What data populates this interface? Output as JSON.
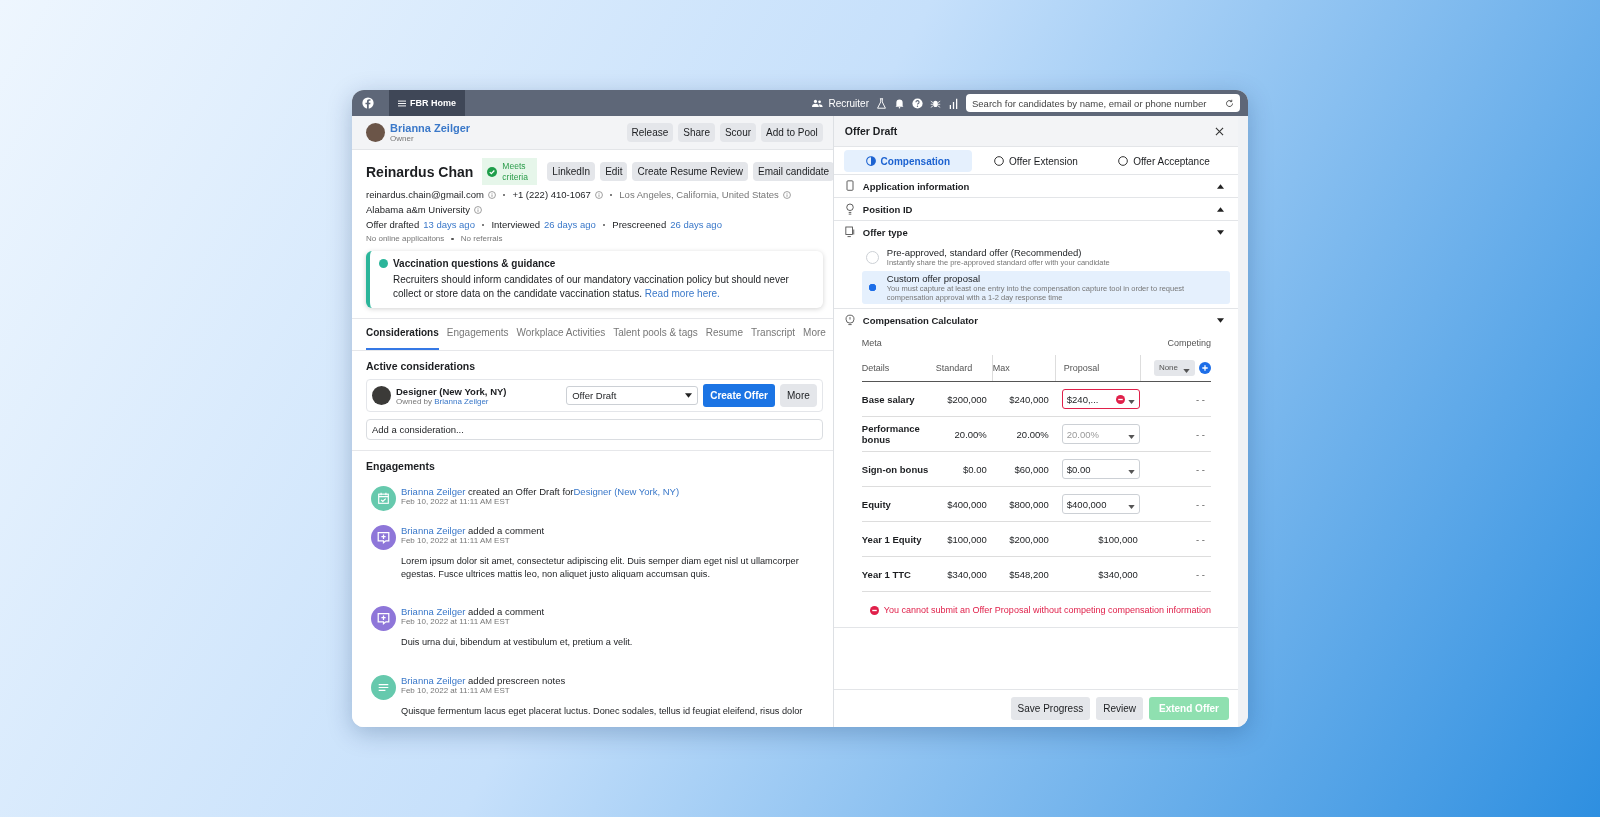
{
  "topbar": {
    "home_tab": "FBR Home",
    "role": "Recruiter",
    "search": {
      "placeholder": "Search for candidates by name, email or phone number"
    }
  },
  "owner": {
    "name": "Brianna Zeilger",
    "role": "Owner",
    "buttons": [
      "Release",
      "Share",
      "Scour",
      "Add to Pool"
    ]
  },
  "candidate": {
    "name": "Reinardus Chan",
    "badge": "Meets criteria",
    "buttons": [
      "LinkedIn",
      "Edit",
      "Create Resume Review",
      "Email candidate"
    ],
    "email": "reinardus.chain@gmail.com",
    "phone": "+1 (222) 410-1067",
    "location": "Los Angeles, California, United States",
    "school": "Alabama a&m University",
    "milestones": [
      {
        "label": "Offer drafted",
        "when": "13 days ago"
      },
      {
        "label": "Interviewed",
        "when": "26 days ago"
      },
      {
        "label": "Prescreened",
        "when": "26 days ago"
      }
    ],
    "notes": [
      "No online applicaitons",
      "No referrals"
    ]
  },
  "notice": {
    "title": "Vaccination questions & guidance",
    "text": "Recruiters should inform candidates of our mandatory vaccination policy but should never collect or store data on the candidate vaccination status.",
    "link": "Read more here."
  },
  "tabs": [
    {
      "label": "Considerations",
      "selected": true
    },
    {
      "label": "Engagements",
      "selected": false
    },
    {
      "label": "Workplace Activities",
      "selected": false
    },
    {
      "label": "Talent pools & tags",
      "selected": false
    },
    {
      "label": "Resume",
      "selected": false
    },
    {
      "label": "Transcript",
      "selected": false
    },
    {
      "label": "More",
      "selected": false
    }
  ],
  "active_considerations": {
    "title": "Active considerations",
    "items": [
      {
        "role": "Designer (New York, NY)",
        "owner_prefix": "Owned by",
        "owner": "Brianna Zeilger",
        "stage": "Offer Draft",
        "primary": "Create Offer",
        "more": "More"
      }
    ],
    "add": {
      "placeholder": "Add a consideration..."
    }
  },
  "engagements": {
    "title": "Engagements",
    "items": [
      {
        "kind": "offer",
        "actor": "Brianna Zeilger",
        "action": "created an Offer Draft for",
        "target": "Designer (New York, NY)",
        "time": "Feb 10, 2022 at 11:11 AM EST"
      },
      {
        "kind": "comment",
        "actor": "Brianna Zeilger",
        "action": "added a comment",
        "time": "Feb 10, 2022 at 11:11 AM EST",
        "body": "Lorem ipsum dolor sit amet, consectetur adipiscing elit. Duis semper diam eget nisl ut ullamcorper egestas. Fusce ultrices mattis leo, non aliquet justo aliquam accumsan quis."
      },
      {
        "kind": "comment",
        "actor": "Brianna Zeilger",
        "action": "added a comment",
        "time": "Feb 10, 2022 at 11:11 AM EST",
        "body": "Duis urna dui, bibendum at vestibulum et, pretium a velit."
      },
      {
        "kind": "notes",
        "actor": "Brianna Zeilger",
        "action": "added prescreen notes",
        "time": "Feb 10, 2022 at 11:11 AM EST",
        "body": "Quisque fermentum lacus eget placerat luctus. Donec sodales, tellus id feugiat eleifend, risus dolor"
      }
    ]
  },
  "offer": {
    "title": "Offer Draft",
    "steps": [
      {
        "label": "Compensation",
        "selected": true
      },
      {
        "label": "Offer Extension",
        "selected": false
      },
      {
        "label": "Offer Acceptance",
        "selected": false
      }
    ],
    "sections": [
      {
        "kind": "application",
        "title": "Application information",
        "expanded": false
      },
      {
        "kind": "position",
        "title": "Position ID",
        "expanded": false
      },
      {
        "kind": "offer_type",
        "title": "Offer type",
        "expanded": true
      },
      {
        "kind": "calculator",
        "title": "Compensation Calculator",
        "expanded": true
      }
    ],
    "offer_types": [
      {
        "title": "Pre-approved, standard offer (Recommended)",
        "subtitle": "Instantly share the pre-approved standard offer with your candidate",
        "selected": false
      },
      {
        "title": "Custom offer proposal",
        "subtitle": "You must capture at least one entry into the compensation capture tool in order to request compensation approval with a 1-2 day response time",
        "selected": true
      }
    ],
    "calculator": {
      "meta": "Meta",
      "competing": "Competing",
      "columns": [
        "Details",
        "Standard",
        "Max",
        "Proposal"
      ],
      "competing_select": "None",
      "rows": [
        {
          "label": "Base salary",
          "standard": "$200,000",
          "max": "$240,000",
          "proposal": {
            "kind": "input",
            "value": "$240,...",
            "error": true
          },
          "competing_value": "- -"
        },
        {
          "label": "Performance bonus",
          "standard": "20.00%",
          "max": "20.00%",
          "proposal": {
            "kind": "input",
            "placeholder": "20.00%",
            "error": false
          },
          "competing_value": "- -"
        },
        {
          "label": "Sign-on bonus",
          "standard": "$0.00",
          "max": "$60,000",
          "proposal": {
            "kind": "input",
            "value": "$0.00",
            "error": false
          },
          "competing_value": "- -"
        },
        {
          "label": "Equity",
          "standard": "$400,000",
          "max": "$800,000",
          "proposal": {
            "kind": "input",
            "value": "$400,000",
            "error": false
          },
          "competing_value": "- -"
        },
        {
          "label": "Year 1 Equity",
          "standard": "$100,000",
          "max": "$200,000",
          "proposal": {
            "kind": "text",
            "value": "$100,000"
          },
          "competing_value": "- -"
        },
        {
          "label": "Year 1 TTC",
          "standard": "$340,000",
          "max": "$548,200",
          "proposal": {
            "kind": "text",
            "value": "$340,000"
          },
          "competing_value": "- -"
        }
      ],
      "error": "You cannot submit an Offer Proposal without competing compensation information"
    },
    "footer": [
      {
        "label": "Save Progress",
        "kind": "secondary",
        "disabled": false
      },
      {
        "label": "Review",
        "kind": "secondary",
        "disabled": false
      },
      {
        "label": "Extend Offer",
        "kind": "primary",
        "disabled": true
      }
    ]
  }
}
